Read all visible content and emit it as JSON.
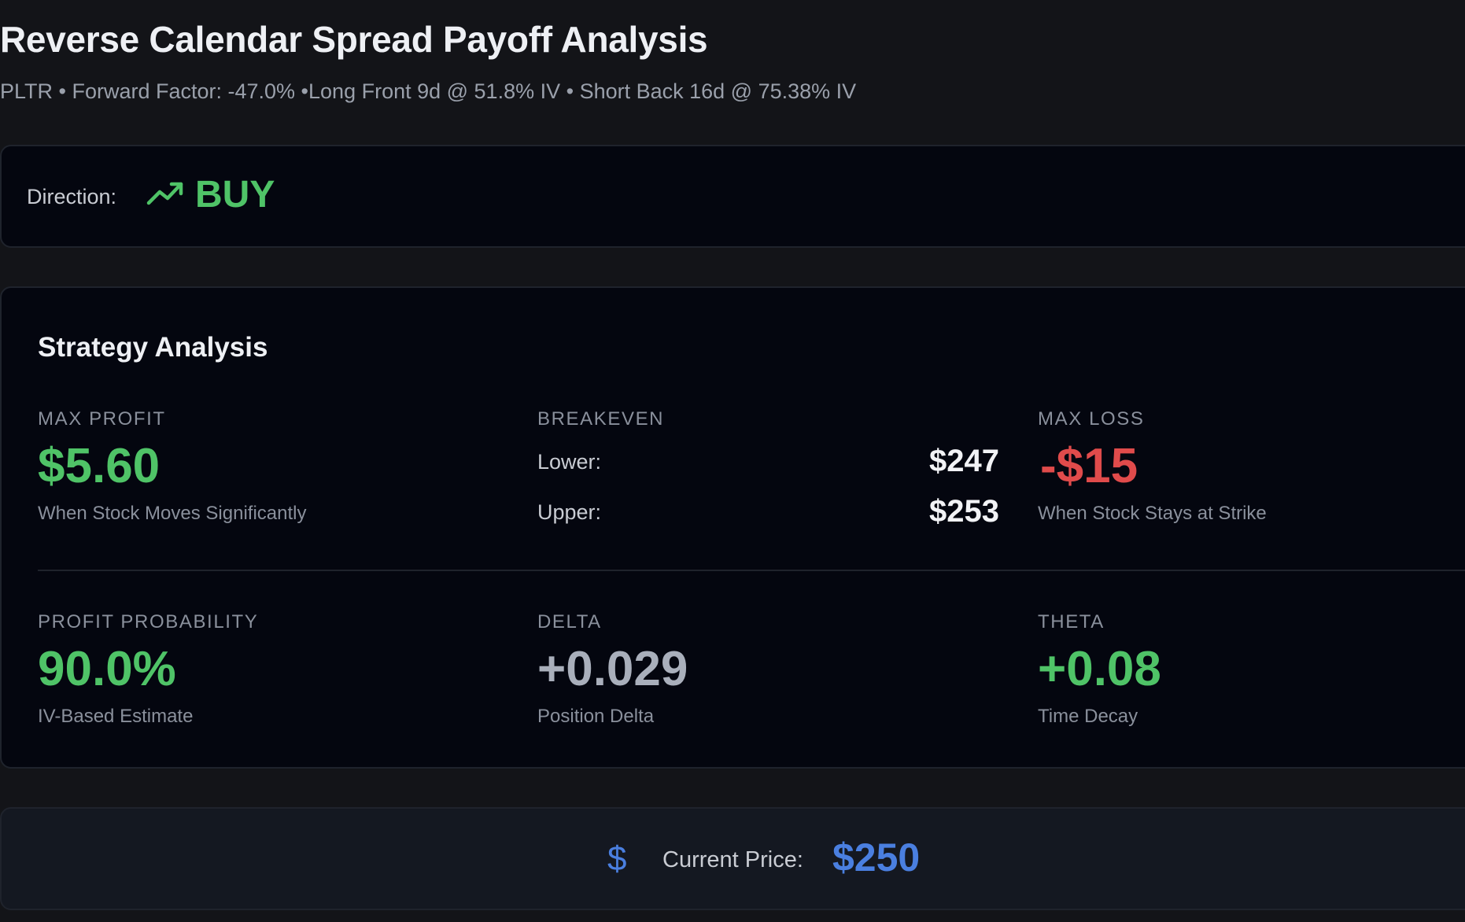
{
  "header": {
    "title": "Reverse Calendar Spread Payoff Analysis",
    "subtitle": "PLTR • Forward Factor: -47.0% •Long Front 9d @ 51.8% IV • Short Back 16d @ 75.38% IV"
  },
  "direction": {
    "label": "Direction:",
    "icon": "trending-up-icon",
    "value": "BUY"
  },
  "strategy": {
    "title": "Strategy Analysis",
    "max_profit": {
      "label": "MAX PROFIT",
      "value": "$5.60",
      "sub": "When Stock Moves Significantly"
    },
    "breakeven": {
      "label": "BREAKEVEN",
      "lower_label": "Lower:",
      "lower_value": "$247",
      "upper_label": "Upper:",
      "upper_value": "$253"
    },
    "max_loss": {
      "label": "MAX LOSS",
      "value": "-$15",
      "sub": "When Stock Stays at Strike"
    },
    "profit_probability": {
      "label": "PROFIT PROBABILITY",
      "value": "90.0%",
      "sub": "IV-Based Estimate"
    },
    "delta": {
      "label": "DELTA",
      "value": "+0.029",
      "sub": "Position Delta"
    },
    "theta": {
      "label": "THETA",
      "value": "+0.08",
      "sub": "Time Decay"
    }
  },
  "current_price": {
    "icon": "dollar-icon",
    "label": "Current Price:",
    "value": "$250"
  },
  "colors": {
    "positive": "#4fc367",
    "negative": "#e04b4b",
    "accent": "#4a7fe0",
    "background": "#131418",
    "card": "#04060f"
  }
}
